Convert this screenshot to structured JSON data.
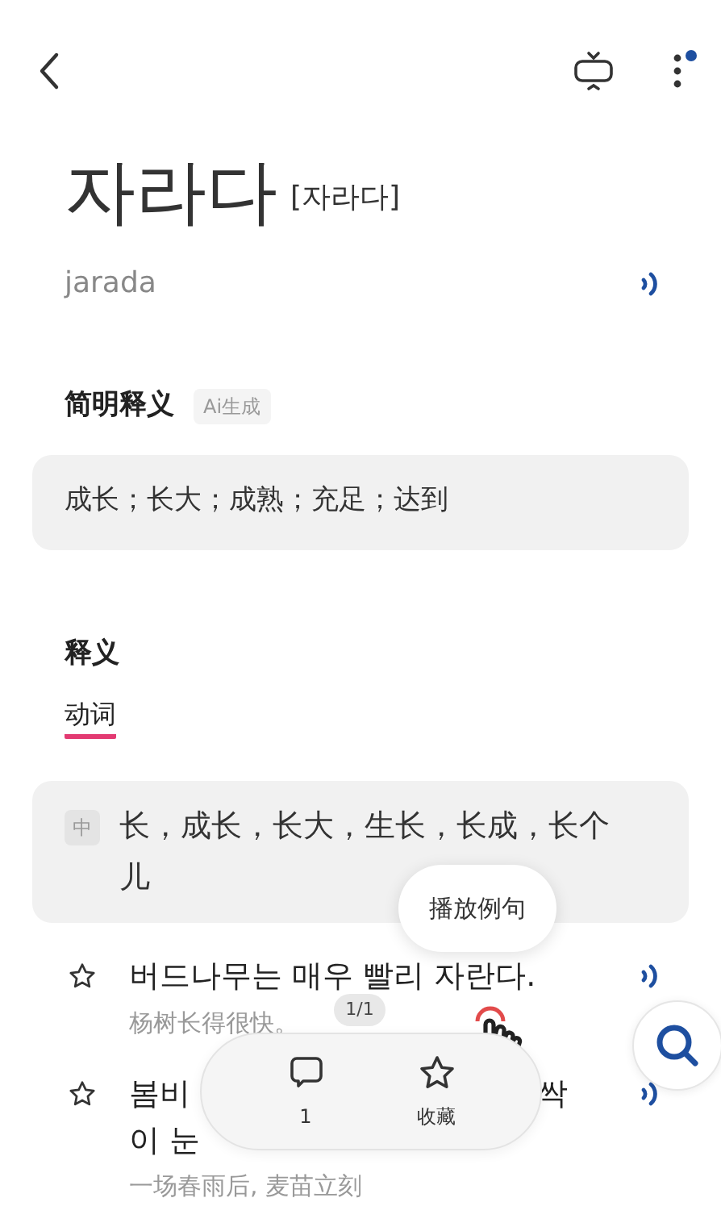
{
  "header": {
    "has_notification": true
  },
  "word": {
    "headword": "자라다",
    "pronunciation": "[자라다]",
    "romanization": "jarada"
  },
  "brief": {
    "title": "简明释义",
    "tag": "Ai生成",
    "text": "成长；长大；成熟；充足；达到"
  },
  "definitions": {
    "title": "释义",
    "pos": [
      {
        "label": "动词",
        "selected": true
      }
    ],
    "senses": [
      {
        "lang_tag": "中",
        "text": "长，成长，长大，生长，长成，长个儿"
      }
    ]
  },
  "examples": [
    {
      "starred": false,
      "sentence_parts": [
        "버드나무는 매우 빨리 자란다."
      ],
      "translation": "杨树长得很快。"
    },
    {
      "starred": false,
      "sentence_parts": [
        "봄비",
        "싹",
        "이 눈"
      ],
      "translation": "一场春雨后, 麦苗立刻"
    }
  ],
  "tooltip": "播放例句",
  "page_indicator": "1/1",
  "action_bar": [
    {
      "kind": "comment",
      "label": "1"
    },
    {
      "kind": "favorite",
      "label": "收藏"
    }
  ]
}
